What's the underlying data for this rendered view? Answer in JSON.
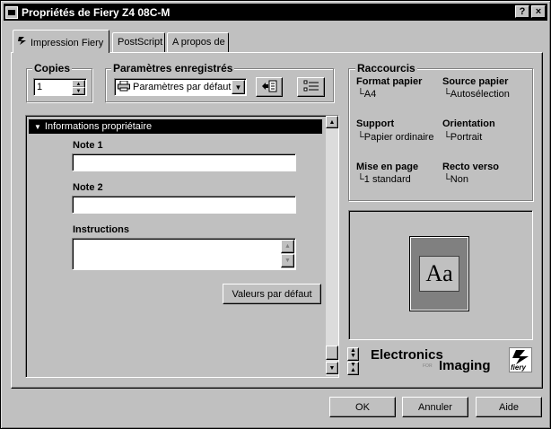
{
  "window": {
    "title": "Propriétés de Fiery Z4 08C-M",
    "help_label": "?",
    "close_label": "×"
  },
  "tabs": [
    {
      "label": "Impression Fiery",
      "icon": "fiery-icon",
      "active": true
    },
    {
      "label": "PostScript",
      "active": false
    },
    {
      "label": "A propos de",
      "active": false
    }
  ],
  "copies": {
    "label": "Copies",
    "value": "1"
  },
  "presets": {
    "label": "Paramètres enregistrés",
    "selected": "Paramètres par défaut",
    "icon": "printer-icon"
  },
  "shortcuts": {
    "label": "Raccourcis",
    "items": [
      {
        "title": "Format papier",
        "value": "A4"
      },
      {
        "title": "Source papier",
        "value": "Autosélection"
      },
      {
        "title": "Support",
        "value": "Papier ordinaire"
      },
      {
        "title": "Orientation",
        "value": "Portrait"
      },
      {
        "title": "Mise en page",
        "value": "1 standard"
      },
      {
        "title": "Recto verso",
        "value": "Non"
      }
    ]
  },
  "section": {
    "header": "Informations propriétaire",
    "note1_label": "Note 1",
    "note1_value": "",
    "note2_label": "Note 2",
    "note2_value": "",
    "instructions_label": "Instructions",
    "instructions_value": "",
    "defaults_button": "Valeurs par défaut"
  },
  "preview": {
    "sample_text": "Aa"
  },
  "logo": {
    "line1": "Electronics",
    "line2": "Imaging",
    "for": "FOR",
    "mark": "fiery"
  },
  "buttons": {
    "ok": "OK",
    "cancel": "Annuler",
    "help": "Aide"
  },
  "colors": {
    "titlebar": "#000000",
    "face": "#c0c0c0",
    "section_header": "#000000"
  }
}
